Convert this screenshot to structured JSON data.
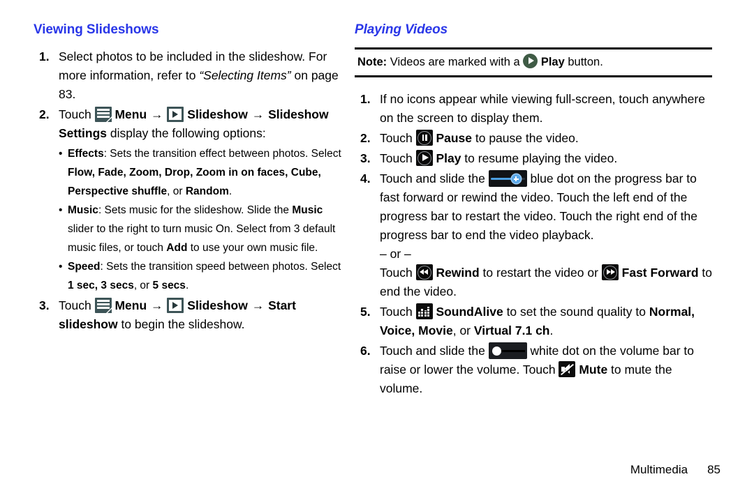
{
  "document": {
    "footer": {
      "chapter": "Multimedia",
      "page_number": "85"
    }
  },
  "left_column": {
    "heading": "Viewing Slideshows",
    "steps": [
      {
        "number": "1.",
        "text_1": "Select photos to be included in the slideshow. For more information, refer to ",
        "italic_ref": "“Selecting Items”",
        "text_2": " on page 83."
      },
      {
        "number": "2.",
        "touch_label": "Touch ",
        "menu_label": "Menu",
        "arrow": "→",
        "slideshow_label": "Slideshow",
        "arrow_2": "→",
        "slideshow_settings_label": "Slideshow Settings",
        "tail": " display the following options:",
        "bullets": [
          {
            "term": "Effects",
            "text_1": ": Sets the transition effect between photos. Select ",
            "options": "Flow, Fade, Zoom, Drop, Zoom in on faces, Cube, Perspective shuffle",
            "text_2": ", or ",
            "option_last": "Random",
            "text_3": "."
          },
          {
            "term": "Music",
            "text_1": ": Sets music for the slideshow. Slide the ",
            "emphasis_1": "Music",
            "text_2": " slider to the right to turn music On. Select from 3 default music files, or touch ",
            "emphasis_2": "Add",
            "text_3": " to use your own music file."
          },
          {
            "term": "Speed",
            "text_1": ": Sets the transition speed between photos. Select ",
            "options": "1 sec, 3 secs",
            "text_2": ", or ",
            "option_last": "5 secs",
            "text_3": "."
          }
        ]
      },
      {
        "number": "3.",
        "touch_label": "Touch ",
        "menu_label": "Menu",
        "arrow": "→",
        "slideshow_label": "Slideshow",
        "arrow_2": "→",
        "start_label": "Start slideshow",
        "tail": " to begin the slideshow."
      }
    ]
  },
  "right_column": {
    "heading": "Playing Videos",
    "note": {
      "prefix": "Note:",
      "text_1": " Videos are marked with a ",
      "button_label": "Play",
      "text_2": " button."
    },
    "steps": [
      {
        "number": "1.",
        "text": "If no icons appear while viewing full-screen, touch anywhere on the screen to display them."
      },
      {
        "number": "2.",
        "touch_label": "Touch ",
        "action_label": "Pause",
        "tail": " to pause the video."
      },
      {
        "number": "3.",
        "touch_label": "Touch ",
        "action_label": "Play",
        "tail": " to resume playing the video."
      },
      {
        "number": "4.",
        "lead": "Touch and slide the ",
        "text_1": " blue dot on the progress bar to fast forward or rewind the video. Touch the left end of the progress bar to restart the video. Touch the right end of the progress bar to end the video playback.",
        "or_divider": "– or –",
        "touch_label": "Touch ",
        "rewind_label": "Rewind",
        "mid_text": " to restart the video or ",
        "fast_forward_label": "Fast Forward",
        "tail": " to end the video."
      },
      {
        "number": "5.",
        "touch_label": "Touch ",
        "action_label": "SoundAlive",
        "text_1": " to set the sound quality to ",
        "options": "Normal, Voice, Movie",
        "text_2": ", or ",
        "option_last": "Virtual 7.1 ch",
        "text_3": "."
      },
      {
        "number": "6.",
        "lead": "Touch and slide the ",
        "text_1": " white dot on the volume bar to raise or lower the volume. Touch ",
        "mute_label": "Mute",
        "tail": " to mute the volume."
      }
    ]
  },
  "icons": {
    "menu": "menu-icon",
    "slideshow": "slideshow-icon",
    "play_circle": "play-circle-icon",
    "pause": "pause-icon",
    "play": "play-icon",
    "progress_bar": "progress-bar-icon",
    "rewind": "rewind-icon",
    "fast_forward": "fast-forward-icon",
    "soundalive": "soundalive-equalizer-icon",
    "volume_bar": "volume-bar-icon",
    "mute": "mute-icon"
  },
  "colors": {
    "heading": "#2a37e8",
    "icon_slate": "#3d5457",
    "icon_black": "#0a0a0a",
    "progress_blue": "#4c9fe0",
    "play_circle_green": "#3f5b45"
  }
}
